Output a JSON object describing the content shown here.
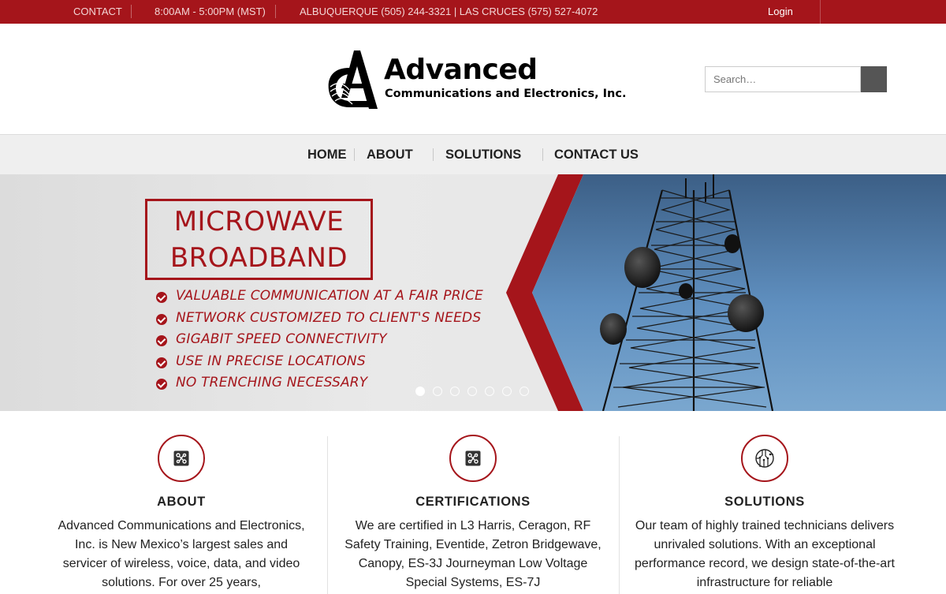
{
  "topbar": {
    "contact": "CONTACT",
    "hours": "8:00AM - 5:00PM (MST)",
    "phones": "ALBUQUERQUE (505) 244-3321 | LAS CRUCES (575) 527-4072",
    "login": "Login"
  },
  "header": {
    "logo_title": "Advanced",
    "logo_subtitle": "Communications and Electronics, Inc.",
    "search_placeholder": "Search…"
  },
  "nav": {
    "items": [
      "HOME",
      "ABOUT",
      "SOLUTIONS",
      "CONTACT US"
    ]
  },
  "hero": {
    "headline_line1": "MICROWAVE",
    "headline_line2": "BROADBAND",
    "bullets": [
      "VALUABLE COMMUNICATION AT A FAIR PRICE",
      "NETWORK CUSTOMIZED TO CLIENT'S NEEDS",
      "GIGABIT SPEED CONNECTIVITY",
      "USE IN PRECISE LOCATIONS",
      "NO TRENCHING NECESSARY"
    ],
    "slide_count": 7,
    "active_slide": 1
  },
  "features": [
    {
      "icon": "circuit-icon",
      "title": "ABOUT",
      "text": "Advanced Communications and Electronics, Inc. is New Mexico’s largest sales and servicer of wireless, voice, data, and video solutions. For over 25 years,"
    },
    {
      "icon": "circuit-icon",
      "title": "CERTIFICATIONS",
      "text": "We are certified in L3 Harris, Ceragon, RF Safety Training, Eventide, Zetron Bridgewave, Canopy, ES-3J Journeyman Low Voltage Special Systems, ES-7J"
    },
    {
      "icon": "chip-icon",
      "title": "SOLUTIONS",
      "text": "Our team of highly trained technicians delivers unrivaled solutions.  With an exceptional performance record, we design state-of-the-art infrastructure for reliable"
    }
  ],
  "colors": {
    "brand_red": "#a5151b",
    "nav_bg": "#efefef",
    "search_button": "#555555"
  }
}
